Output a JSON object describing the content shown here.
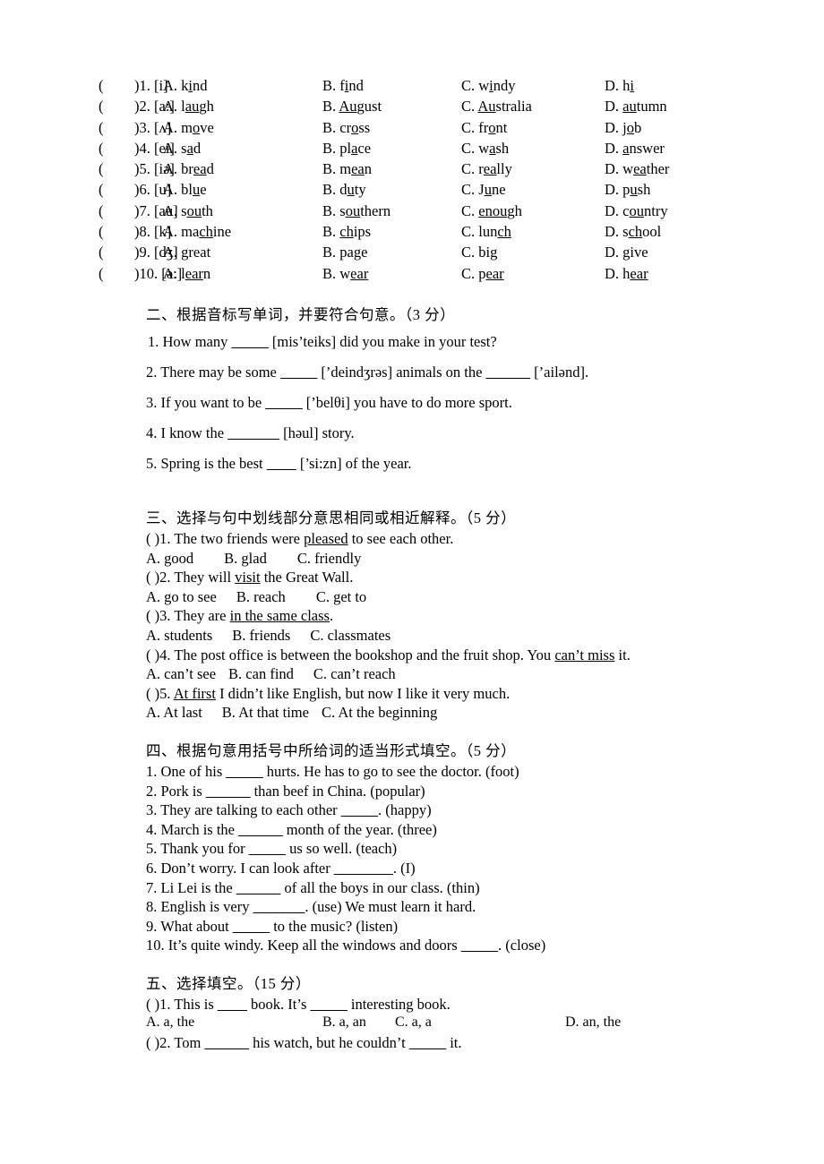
{
  "document": {
    "type": "english-exam-paper",
    "language": "zh-CN/en"
  },
  "section_one": {
    "rows": [
      {
        "bracket": "(",
        "close": ")",
        "num": "1.",
        "phonetic": "[i]",
        "a": "A. kind",
        "a_pre": "A. k",
        "a_u": "i",
        "a_post": "nd",
        "b_pre": "B. f",
        "b_u": "i",
        "b_post": "nd",
        "c_pre": "C. w",
        "c_u": "i",
        "c_post": "ndy",
        "d_pre": "D. h",
        "d_u": "i",
        "d_post": ""
      },
      {
        "bracket": "(",
        "close": ")",
        "num": "2.",
        "phonetic": "[a:]",
        "a_pre": "A. l",
        "a_u": "au",
        "a_post": "gh",
        "b_pre": "B. ",
        "b_u": "Au",
        "b_post": "gust",
        "c_pre": "C. ",
        "c_u": "Au",
        "c_post": "stralia",
        "d_pre": "D. ",
        "d_u": "au",
        "d_post": "tumn"
      },
      {
        "bracket": "(",
        "close": ")",
        "num": "3.",
        "phonetic": "[ʌ]",
        "a_pre": "A. m",
        "a_u": "o",
        "a_post": "ve",
        "b_pre": "B. cr",
        "b_u": "o",
        "b_post": "ss",
        "c_pre": "C. fr",
        "c_u": "o",
        "c_post": "nt",
        "d_pre": "D. j",
        "d_u": "o",
        "d_post": "b"
      },
      {
        "bracket": "(",
        "close": ")",
        "num": "4.",
        "phonetic": "[ei]",
        "a_pre": "A. s",
        "a_u": "a",
        "a_post": "d",
        "b_pre": "B. pl",
        "b_u": "a",
        "b_post": "ce",
        "c_pre": "C. w",
        "c_u": "a",
        "c_post": "sh",
        "d_pre": "D. ",
        "d_u": "a",
        "d_post": "nswer"
      },
      {
        "bracket": "(",
        "close": ")",
        "num": "5.",
        "phonetic": "[iə]",
        "a_pre": "A. br",
        "a_u": "ea",
        "a_post": "d",
        "b_pre": "B. m",
        "b_u": "ea",
        "b_post": "n",
        "c_pre": "C. r",
        "c_u": "ea",
        "c_post": "lly",
        "d_pre": "D. w",
        "d_u": "ea",
        "d_post": "ther"
      },
      {
        "bracket": "(",
        "close": ")",
        "num": "6.",
        "phonetic": "[u]",
        "a_pre": "A. bl",
        "a_u": "u",
        "a_post": "e",
        "b_pre": "B. d",
        "b_u": "u",
        "b_post": "ty",
        "c_pre": "C. J",
        "c_u": "u",
        "c_post": "ne",
        "d_pre": "D. p",
        "d_u": "u",
        "d_post": "sh"
      },
      {
        "bracket": "(",
        "close": ")",
        "num": "7.",
        "phonetic": "[au]",
        "a_pre": "A. s",
        "a_u": "ou",
        "a_post": "th",
        "b_pre": "B. s",
        "b_u": "ou",
        "b_post": "thern",
        "c_pre": "C. ",
        "c_u": "enou",
        "c_post": "gh",
        "d_pre": "D. c",
        "d_u": "ou",
        "d_post": "ntry"
      },
      {
        "bracket": "(",
        "close": ")",
        "num": "8.",
        "phonetic": "[k]",
        "a_pre": "A. ma",
        "a_u": "ch",
        "a_post": "ine",
        "b_pre": "B. ",
        "b_u": "ch",
        "b_post": "ips",
        "c_pre": "C. lun",
        "c_u": "ch",
        "c_post": "",
        "d_pre": "D. s",
        "d_u": "ch",
        "d_post": "ool"
      },
      {
        "bracket": "(",
        "close": ")",
        "num": "9.",
        "phonetic": "[dʒ]",
        "a_pre": "A. ",
        "a_u": "g",
        "a_post": "reat",
        "b_pre": "B. pa",
        "b_u": "g",
        "b_post": "e",
        "c_pre": "C. bi",
        "c_u": "g",
        "c_post": "",
        "d_pre": "D. ",
        "d_u": "g",
        "d_post": "ive"
      },
      {
        "bracket": "(",
        "close": ")",
        "num": "10.",
        "phonetic": "[ə:]",
        "a_pre": "A. l",
        "a_u": "ear",
        "a_post": "n",
        "b_pre": "B. w",
        "b_u": "ear",
        "b_post": "",
        "c_pre": "C. p",
        "c_u": "ear",
        "c_post": "",
        "d_pre": "D. h",
        "d_u": "ear",
        "d_post": ""
      }
    ]
  },
  "section_two": {
    "heading": "二、根据音标写单词，并要符合句意。（3 分）",
    "questions": [
      {
        "num": "1.",
        "pre": "How many",
        "blank": "_____",
        "mid": "[mis’teiks] did you make in your test?",
        "post": ""
      },
      {
        "num": "2.",
        "pre": "There may be some",
        "blank": "_____",
        "mid": "[’deindʒrəs] animals on the",
        "blank2": "______",
        "post": "[’ailənd]."
      },
      {
        "num": "3.",
        "pre": "If you want to be",
        "blank": "_____",
        "mid": "[’belθi] you have to do more sport.",
        "post": ""
      },
      {
        "num": "4.",
        "pre": "I know the",
        "blank": "_______",
        "mid": "[həul] story.",
        "post": ""
      },
      {
        "num": "5.",
        "pre": "Spring is the best",
        "blank": "____",
        "mid": "[’si:zn] of the year.",
        "post": ""
      }
    ]
  },
  "section_three": {
    "heading": "三、选择与句中划线部分意思相同或相近解释。（5 分）",
    "questions": [
      {
        "marker": "( )1.",
        "stem_pre": "The two friends were ",
        "stem_u": "pleased",
        "stem_post": " to see each other.",
        "options": [
          "A. good",
          "B. glad",
          "C. friendly"
        ]
      },
      {
        "marker": "( )2.",
        "stem_pre": "They will ",
        "stem_u": "visit",
        "stem_post": " the Great Wall.",
        "options": [
          "A. go to see",
          "B. reach",
          "C. get to"
        ]
      },
      {
        "marker": "( )3.",
        "stem_pre": "They are ",
        "stem_u": "in the same class",
        "stem_post": ".",
        "options": [
          "A. students",
          "B. friends",
          "C. classmates"
        ]
      },
      {
        "marker": "( )4.",
        "stem_pre": "The post office is between the bookshop and the fruit shop. You ",
        "stem_u": "can’t miss",
        "stem_post": " it.",
        "options": [
          "A. can’t see",
          "B. can find",
          "C. can’t reach"
        ]
      },
      {
        "marker": "( )5.",
        "stem_pre": "",
        "stem_u": "At first",
        "stem_post": " I didn’t like English, but now I like it very much.",
        "options": [
          "A. At last",
          "B. At that time",
          "C. At the beginning"
        ]
      }
    ]
  },
  "section_four": {
    "heading": "四、根据句意用括号中所给词的适当形式填空。（5 分）",
    "questions": [
      {
        "num": "1.",
        "pre": "One of his ",
        "blank": "_____",
        "post": " hurts. He has to go to see the doctor. (foot)"
      },
      {
        "num": "2.",
        "pre": "Pork is ",
        "blank": "______",
        "post": " than beef in China. (popular)"
      },
      {
        "num": "3.",
        "pre": "They are talking to each other ",
        "blank": "_____",
        "post": ". (happy)"
      },
      {
        "num": "4.",
        "pre": "March is the ",
        "blank": "______",
        "post": " month of the year. (three)"
      },
      {
        "num": "5.",
        "pre": "Thank you for ",
        "blank": "_____",
        "post": " us so well. (teach)"
      },
      {
        "num": "6.",
        "pre": "Don’t worry. I can look after ",
        "blank": "________",
        "post": ". (I)"
      },
      {
        "num": "7.",
        "pre": "Li Lei is the ",
        "blank": "______",
        "post": " of all the boys in our class. (thin)"
      },
      {
        "num": "8.",
        "pre": "English is very ",
        "blank": "_______",
        "post": ". (use) We must learn it hard."
      },
      {
        "num": "9.",
        "pre": "What about ",
        "blank": "_____",
        "post": " to the music? (listen)"
      },
      {
        "num": "10.",
        "pre": "It’s quite windy. Keep all the windows and doors ",
        "blank": "_____",
        "post": ". (close)"
      }
    ]
  },
  "section_five": {
    "heading": "五、选择填空。（15 分）",
    "questions": [
      {
        "marker": "( )1.",
        "stem_pre": "This is ",
        "blank1": "____",
        "stem_mid": " book. It’s ",
        "blank2": "_____",
        "stem_post": " interesting book.",
        "options": [
          "A. a, the",
          "B. a, an",
          "C. a, a",
          "D. an, the"
        ]
      },
      {
        "marker": "( )2.",
        "stem_pre": "Tom ",
        "blank1": "______",
        "stem_mid": " his watch, but he couldn’t ",
        "blank2": "_____",
        "stem_post": " it.",
        "options": []
      }
    ]
  }
}
